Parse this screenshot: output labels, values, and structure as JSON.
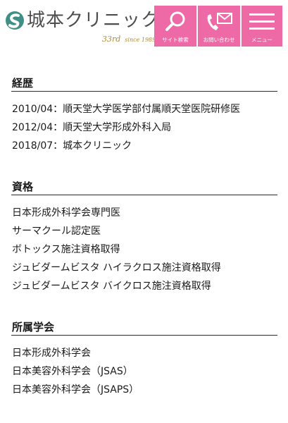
{
  "header": {
    "logo_text": "城本クリニック",
    "logo_years": "33rd",
    "logo_since": "since 1989",
    "buttons": {
      "search": {
        "label": "サイト検索",
        "icon": "search-icon"
      },
      "contact": {
        "label": "お問い合わせ",
        "icon": "phone-mail-icon"
      },
      "menu": {
        "label": "メニュー",
        "icon": "hamburger-icon"
      }
    },
    "accent_color": "#ee6aa7"
  },
  "sections": {
    "career": {
      "title": "経歴",
      "items": [
        "2010/04：順天堂大学医学部付属順天堂医院研修医",
        "2012/04：順天堂大学形成外科入局",
        "2018/07：城本クリニック"
      ]
    },
    "qualifications": {
      "title": "資格",
      "items": [
        "日本形成外科学会専門医",
        "サーマクール認定医",
        "ボトックス施注資格取得",
        "ジュビダームビスタ ハイラクロス施注資格取得",
        "ジュビダームビスタ バイクロス施注資格取得"
      ]
    },
    "societies": {
      "title": "所属学会",
      "items": [
        "日本形成外科学会",
        "日本美容外科学会（JSAS）",
        "日本美容外科学会（JSAPS）"
      ]
    }
  }
}
